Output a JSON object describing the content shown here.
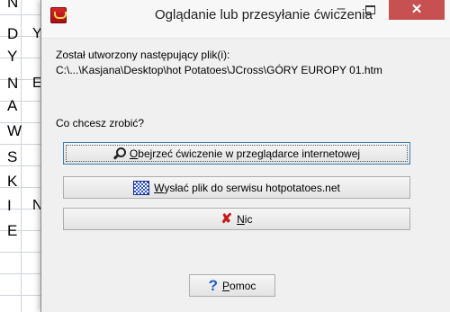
{
  "background": {
    "letters": [
      "N",
      "D",
      "Y",
      "N",
      "A",
      "W",
      "S",
      "K",
      "I",
      "E"
    ],
    "peek_letters": [
      "Y",
      "E",
      "N"
    ]
  },
  "dialog": {
    "title": "Oglądanie lub przesyłanie ćwiczenia",
    "minimize_label": "–",
    "close_label": "✕",
    "created_line": "Został utworzony następujący plik(i):",
    "file_path": "C:\\...\\Kasjana\\Desktop\\hot Potatoes\\JCross\\GÓRY EUROPY 01.htm",
    "question": "Co chcesz zrobić?",
    "buttons": {
      "view_prefix": "O",
      "view_rest": "bejrzeć ćwiczenie w przeglądarce internetowej",
      "upload_prefix": "W",
      "upload_rest": "ysłać plik do serwisu hotpotatoes.net",
      "nothing_prefix": "N",
      "nothing_rest": "ic",
      "help_prefix": "P",
      "help_rest": "omoc"
    },
    "icons": {
      "view": "magnifier-icon",
      "upload": "upload-icon",
      "nothing": "red-x-icon",
      "help": "question-icon",
      "app": "hot-potatoes-icon"
    },
    "colors": {
      "close_button": "#c75050",
      "help_icon": "#1b5fc8",
      "cancel_icon": "#c81818"
    }
  }
}
